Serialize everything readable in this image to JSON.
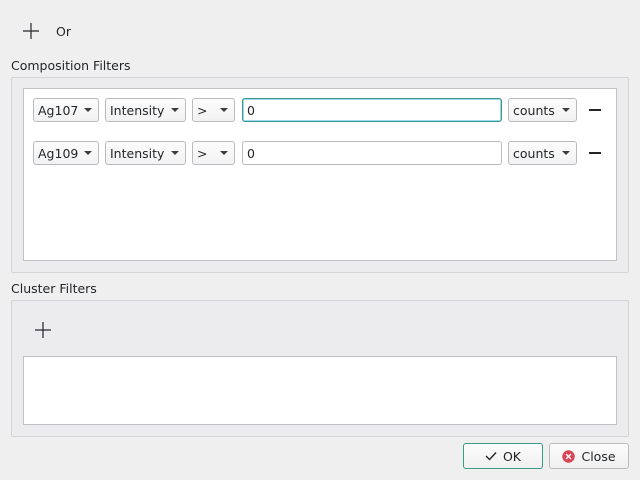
{
  "top": {
    "or_label": "Or"
  },
  "composition": {
    "title": "Composition Filters",
    "rows": [
      {
        "element": "Ag107",
        "property": "Intensity",
        "operator": ">",
        "value": "0",
        "unit": "counts"
      },
      {
        "element": "Ag109",
        "property": "Intensity",
        "operator": ">",
        "value": "0",
        "unit": "counts"
      }
    ]
  },
  "cluster": {
    "title": "Cluster Filters"
  },
  "buttons": {
    "ok": "OK",
    "close": "Close"
  },
  "colors": {
    "accent": "#3b9a86",
    "close_icon": "#da4453"
  }
}
